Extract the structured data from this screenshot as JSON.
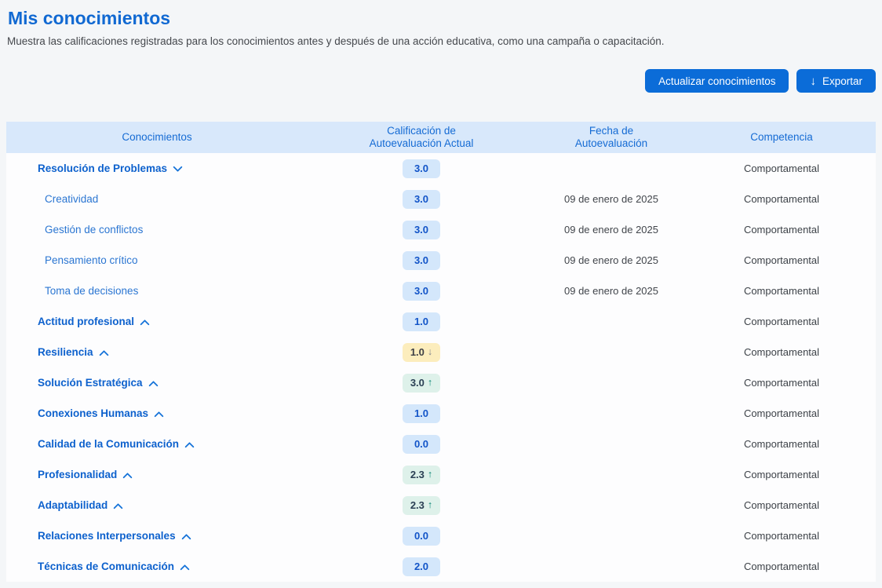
{
  "page": {
    "title": "Mis conocimientos",
    "subtitle": "Muestra las calificaciones registradas para los conocimientos antes y después de una acción educativa, como una campaña o capacitación."
  },
  "toolbar": {
    "update_label": "Actualizar conocimientos",
    "export_label": "Exportar",
    "export_icon": "↓"
  },
  "colors": {
    "accent_blue": "#0b6cd8",
    "header_bg": "#d8e8fb",
    "badge_blue_bg": "#d4e7fb",
    "badge_yellow_bg": "#fcedbd",
    "badge_green_bg": "#def1ea",
    "page_bg": "#f4f6f8"
  },
  "table": {
    "headers": [
      "Conocimientos",
      "Calificación de\nAutoevaluación Actual",
      "Fecha de\nAutoevaluación",
      "Competencia"
    ],
    "rows": [
      {
        "label": "Resolución de Problemas",
        "level": "parent",
        "chevron": "down",
        "score": "3.0",
        "trend": null,
        "variant": "blue",
        "date": "",
        "competencia": "Comportamental"
      },
      {
        "label": "Creatividad",
        "level": "child",
        "chevron": null,
        "score": "3.0",
        "trend": null,
        "variant": "blue",
        "date": "09 de enero de 2025",
        "competencia": "Comportamental"
      },
      {
        "label": "Gestión de conflictos",
        "level": "child",
        "chevron": null,
        "score": "3.0",
        "trend": null,
        "variant": "blue",
        "date": "09 de enero de 2025",
        "competencia": "Comportamental"
      },
      {
        "label": "Pensamiento crítico",
        "level": "child",
        "chevron": null,
        "score": "3.0",
        "trend": null,
        "variant": "blue",
        "date": "09 de enero de 2025",
        "competencia": "Comportamental"
      },
      {
        "label": "Toma de decisiones",
        "level": "child",
        "chevron": null,
        "score": "3.0",
        "trend": null,
        "variant": "blue",
        "date": "09 de enero de 2025",
        "competencia": "Comportamental"
      },
      {
        "label": "Actitud profesional",
        "level": "parent",
        "chevron": "up",
        "score": "1.0",
        "trend": null,
        "variant": "blue",
        "date": "",
        "competencia": "Comportamental"
      },
      {
        "label": "Resiliencia",
        "level": "parent",
        "chevron": "up",
        "score": "1.0",
        "trend": "down",
        "variant": "yellow",
        "date": "",
        "competencia": "Comportamental"
      },
      {
        "label": "Solución Estratégica",
        "level": "parent",
        "chevron": "up",
        "score": "3.0",
        "trend": "up",
        "variant": "green",
        "date": "",
        "competencia": "Comportamental"
      },
      {
        "label": "Conexiones Humanas",
        "level": "parent",
        "chevron": "up",
        "score": "1.0",
        "trend": null,
        "variant": "blue",
        "date": "",
        "competencia": "Comportamental"
      },
      {
        "label": "Calidad de la Comunicación",
        "level": "parent",
        "chevron": "up",
        "score": "0.0",
        "trend": null,
        "variant": "blue",
        "date": "",
        "competencia": "Comportamental"
      },
      {
        "label": "Profesionalidad",
        "level": "parent",
        "chevron": "up",
        "score": "2.3",
        "trend": "up",
        "variant": "green",
        "date": "",
        "competencia": "Comportamental"
      },
      {
        "label": "Adaptabilidad",
        "level": "parent",
        "chevron": "up",
        "score": "2.3",
        "trend": "up",
        "variant": "green",
        "date": "",
        "competencia": "Comportamental"
      },
      {
        "label": "Relaciones Interpersonales",
        "level": "parent",
        "chevron": "up",
        "score": "0.0",
        "trend": null,
        "variant": "blue",
        "date": "",
        "competencia": "Comportamental"
      },
      {
        "label": "Técnicas de Comunicación",
        "level": "parent",
        "chevron": "up",
        "score": "2.0",
        "trend": null,
        "variant": "blue",
        "date": "",
        "competencia": "Comportamental"
      }
    ]
  }
}
